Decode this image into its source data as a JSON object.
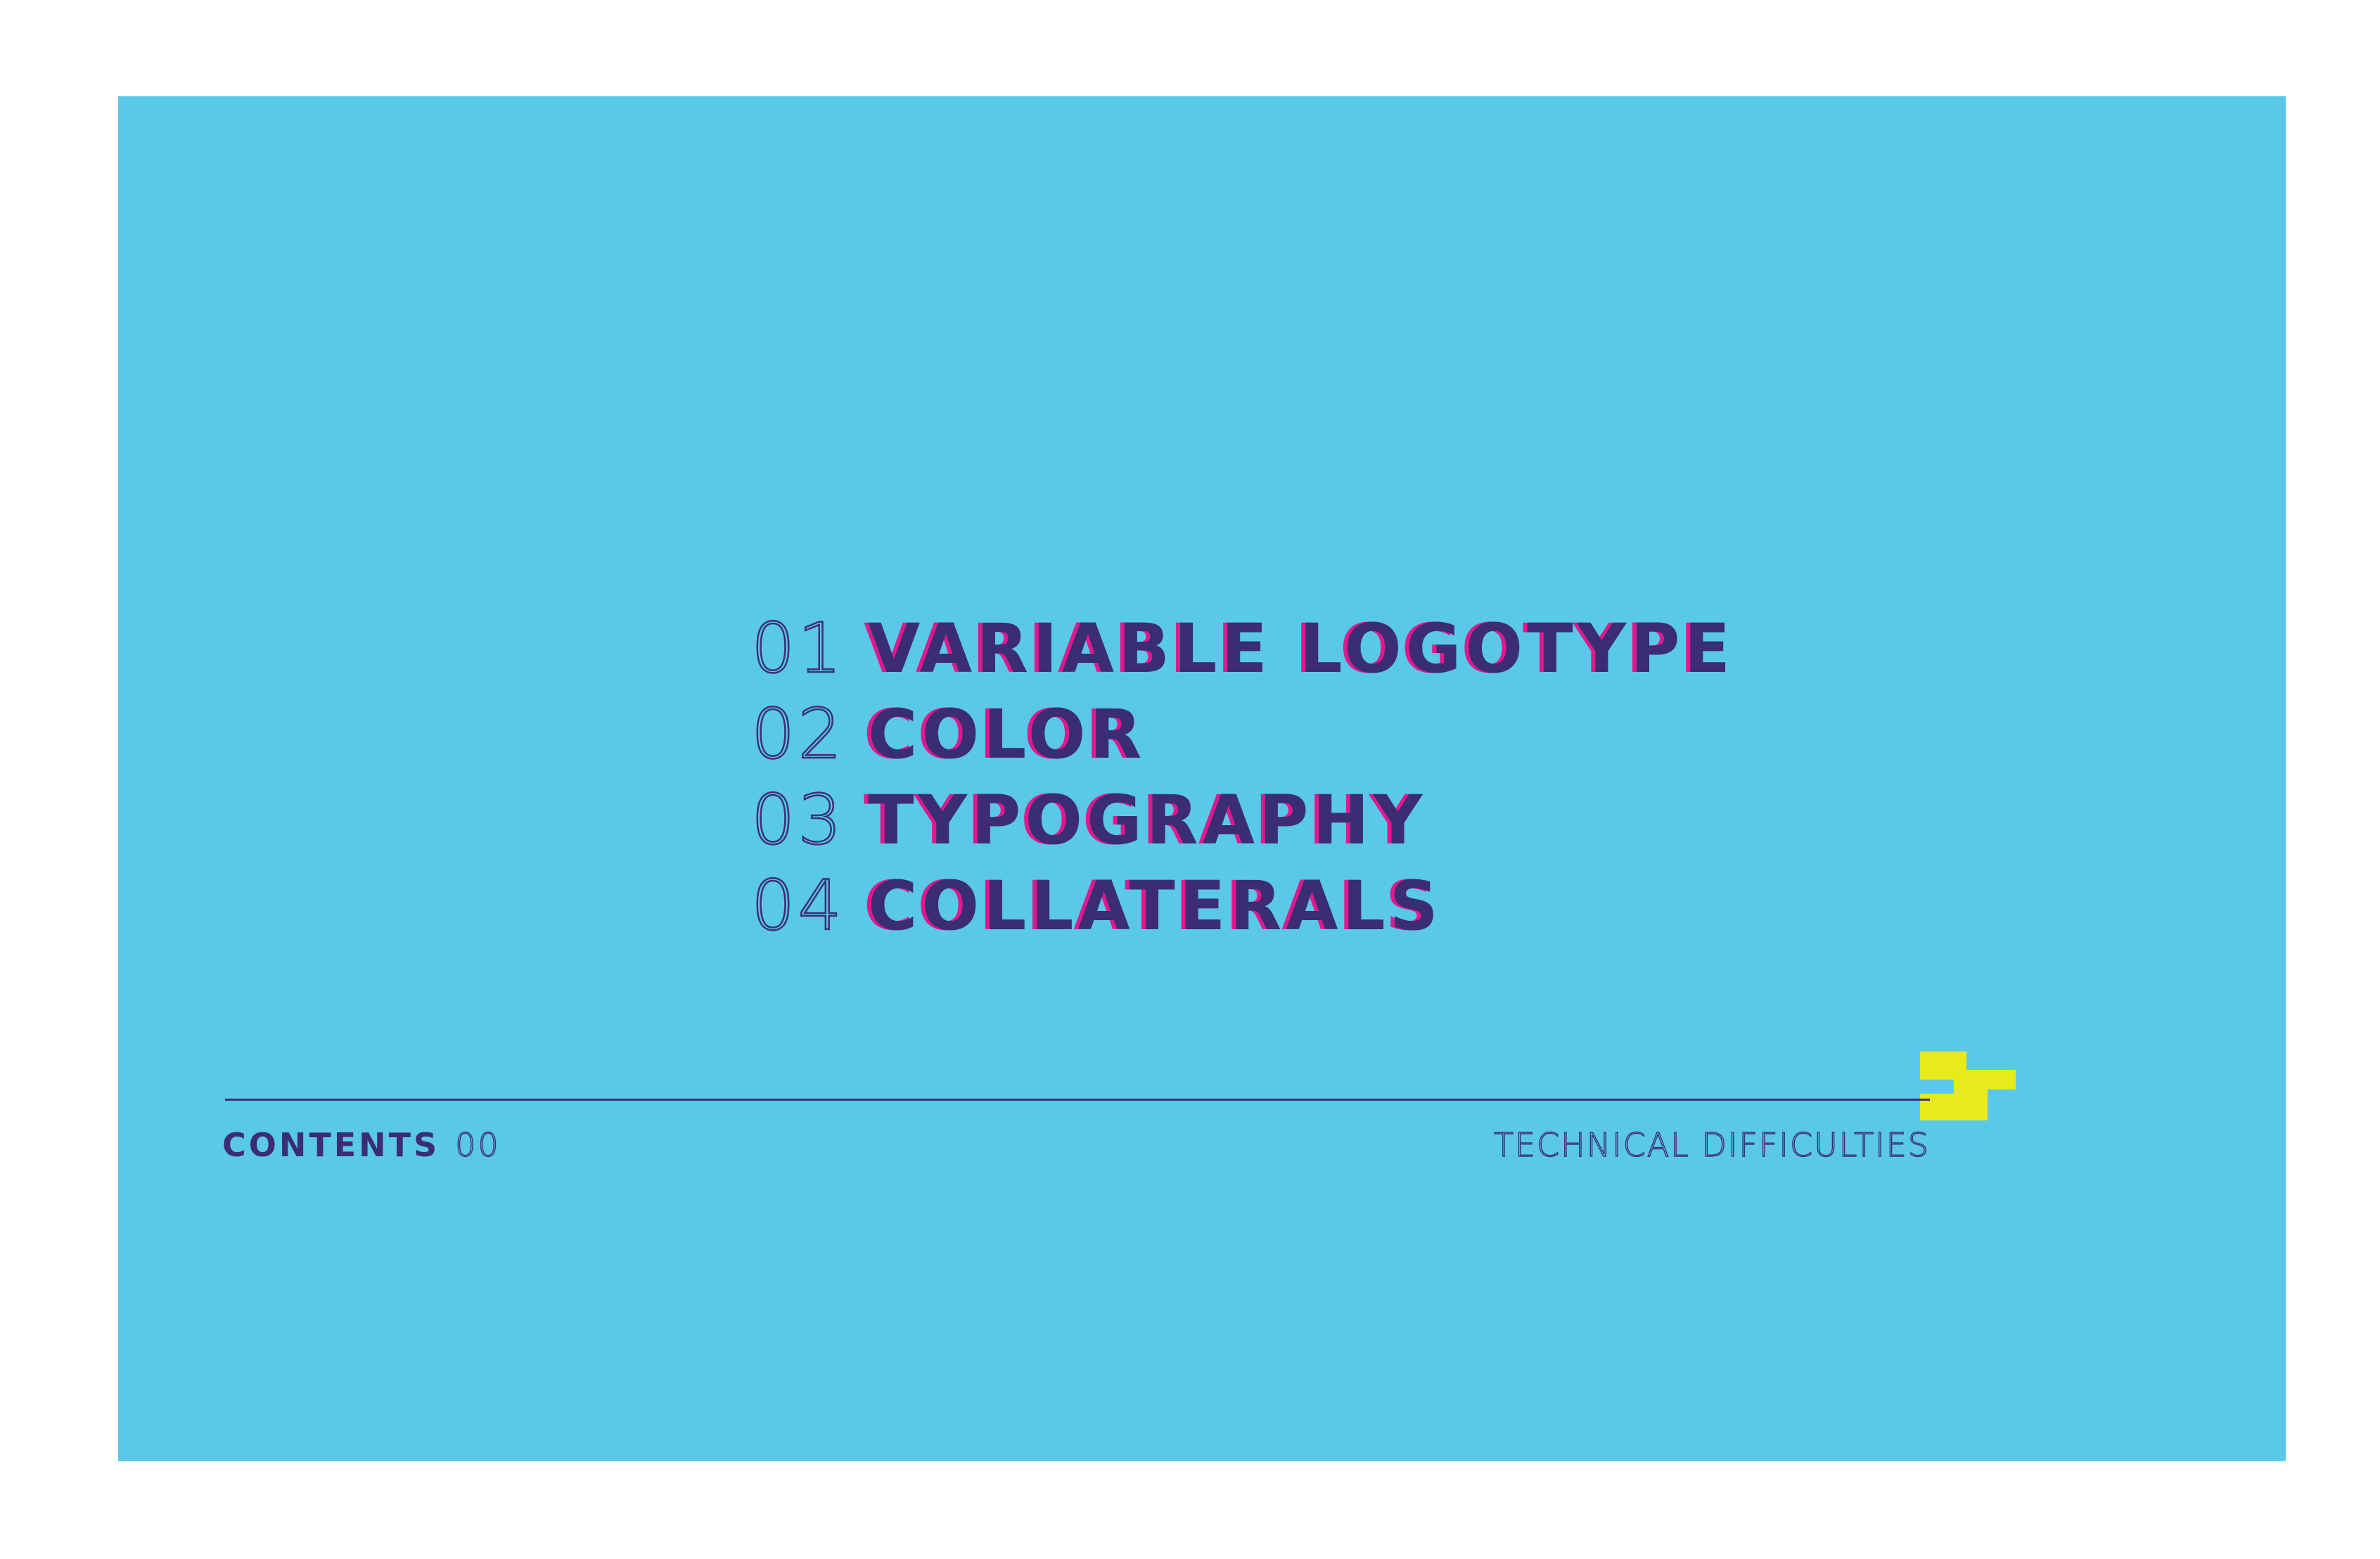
{
  "colors": {
    "background": "#5AC8E9",
    "primary_text": "#3A2D73",
    "accent_shadow": "#E0188B",
    "logo": "#E8EA1C"
  },
  "contents": {
    "items": [
      {
        "number": "01",
        "title": "VARIABLE LOGOTYPE"
      },
      {
        "number": "02",
        "title": "COLOR"
      },
      {
        "number": "03",
        "title": "TYPOGRAPHY"
      },
      {
        "number": "04",
        "title": "COLLATERALS"
      }
    ]
  },
  "logo": {
    "icon": "brand-mark-icon"
  },
  "footer": {
    "section_label": "CONTENTS",
    "page_number": "00",
    "brand_name": "TECHNICAL DIFFICULTIES"
  }
}
